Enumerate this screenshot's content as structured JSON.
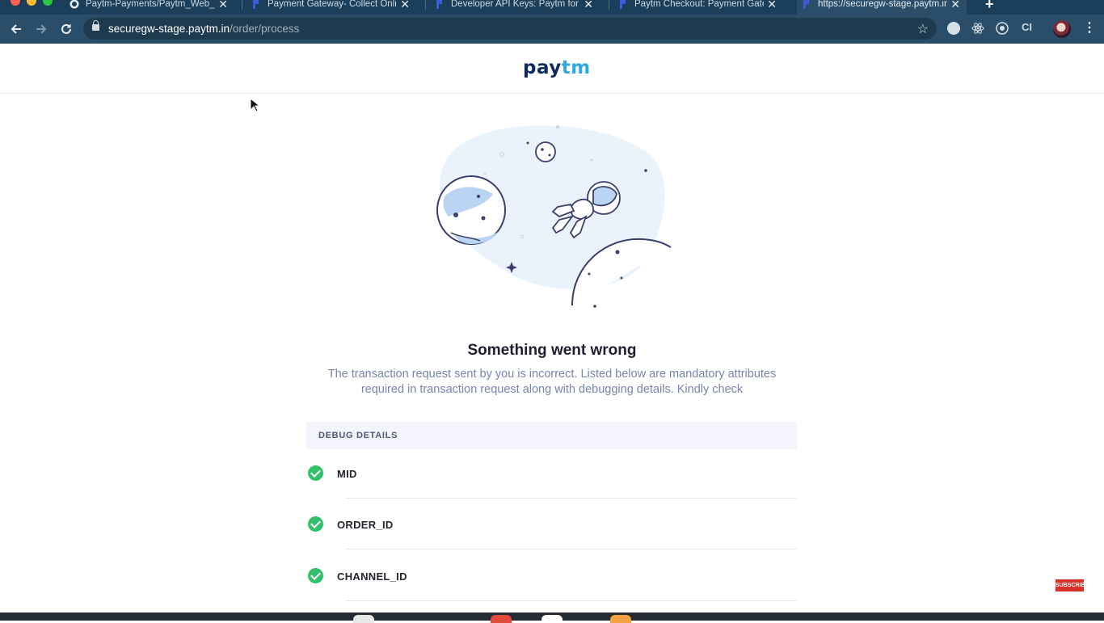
{
  "browser": {
    "tabs": [
      {
        "title": "Paytm-Payments/Paytm_Web_Sample",
        "active": false
      },
      {
        "title": "Payment Gateway- Collect Online Payments",
        "active": false
      },
      {
        "title": "Developer API Keys: Paytm for your Business",
        "active": false
      },
      {
        "title": "Paytm Checkout: Payment Gateway",
        "active": false
      },
      {
        "title": "https://securegw-stage.paytm.in",
        "active": true
      }
    ],
    "close_glyph": "✕",
    "new_tab_glyph": "+",
    "url_host": "securegw-stage.paytm.in",
    "url_path": "/order/process",
    "extension_label": "CI"
  },
  "page": {
    "logo_part1": "pay",
    "logo_part2": "tm",
    "heading": "Something went wrong",
    "description": "The transaction request sent by you is incorrect. Listed below are mandatory attributes required in transaction request along with debugging details. Kindly check",
    "debug_title": "DEBUG DETAILS",
    "debug_items": [
      {
        "label": "MID",
        "status": "ok"
      },
      {
        "label": "ORDER_ID",
        "status": "ok"
      },
      {
        "label": "CHANNEL_ID",
        "status": "ok"
      }
    ]
  },
  "overlay": {
    "subscribe_label": "SUBSCRIBE"
  },
  "colors": {
    "check_green": "#33c06a",
    "paytm_navy": "#0f2b5e",
    "paytm_blue": "#2fa9e0",
    "chrome_bg": "#2a4e69",
    "tabstrip_bg": "#1b3f5a"
  },
  "icons": {
    "back": "arrow-left-icon",
    "forward": "arrow-right-icon",
    "reload": "reload-icon",
    "lock": "lock-icon",
    "bookmark": "star-icon",
    "menu": "kebab-menu-icon",
    "check": "check-circle-icon",
    "illustration": "astronaut-space-illustration"
  }
}
